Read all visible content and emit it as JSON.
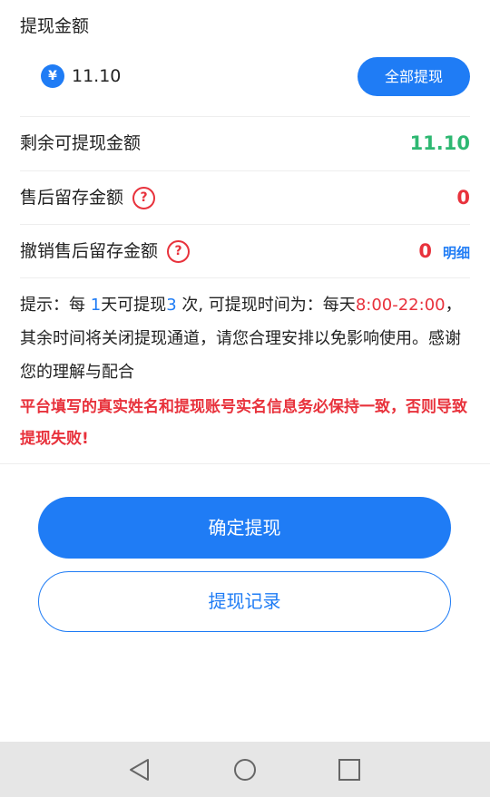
{
  "withdraw": {
    "section_title": "提现金额",
    "currency_symbol": "¥",
    "amount_value": "11.10",
    "all_button_label": "全部提现"
  },
  "rows": [
    {
      "label": "剩余可提现金额",
      "value": "11.10",
      "value_color": "#2eb872"
    },
    {
      "label": "售后留存金额",
      "value": "0",
      "value_color": "#e8323c",
      "help_icon": "question-circle-icon"
    },
    {
      "label": "撤销售后留存金额",
      "value": "0",
      "value_color": "#e8323c",
      "help_icon": "question-circle-icon",
      "link_label": "明细"
    }
  ],
  "notice": {
    "prefix": "提示：每 ",
    "times_days": "1",
    "text_mid1": "天可提现",
    "times_count": "3",
    "text_mid2": " 次, 可提现时间为：每天",
    "time_start": "8:00-",
    "time_end": "22:00",
    "text_end": "，其余时间将关闭提现通道，请您合理安排以免影响使用。感谢您的理解与配合"
  },
  "warning": "平台填写的真实姓名和提现账号实名信息务必保持一致，否则导致提现失败!",
  "buttons": {
    "confirm_label": "确定提现",
    "record_label": "提现记录"
  },
  "nav": {
    "back_icon": "triangle-back-icon",
    "home_icon": "circle-home-icon",
    "recents_icon": "square-recents-icon"
  },
  "colors": {
    "accent": "#1f7cf5",
    "green": "#2eb872",
    "red": "#e8323c"
  }
}
